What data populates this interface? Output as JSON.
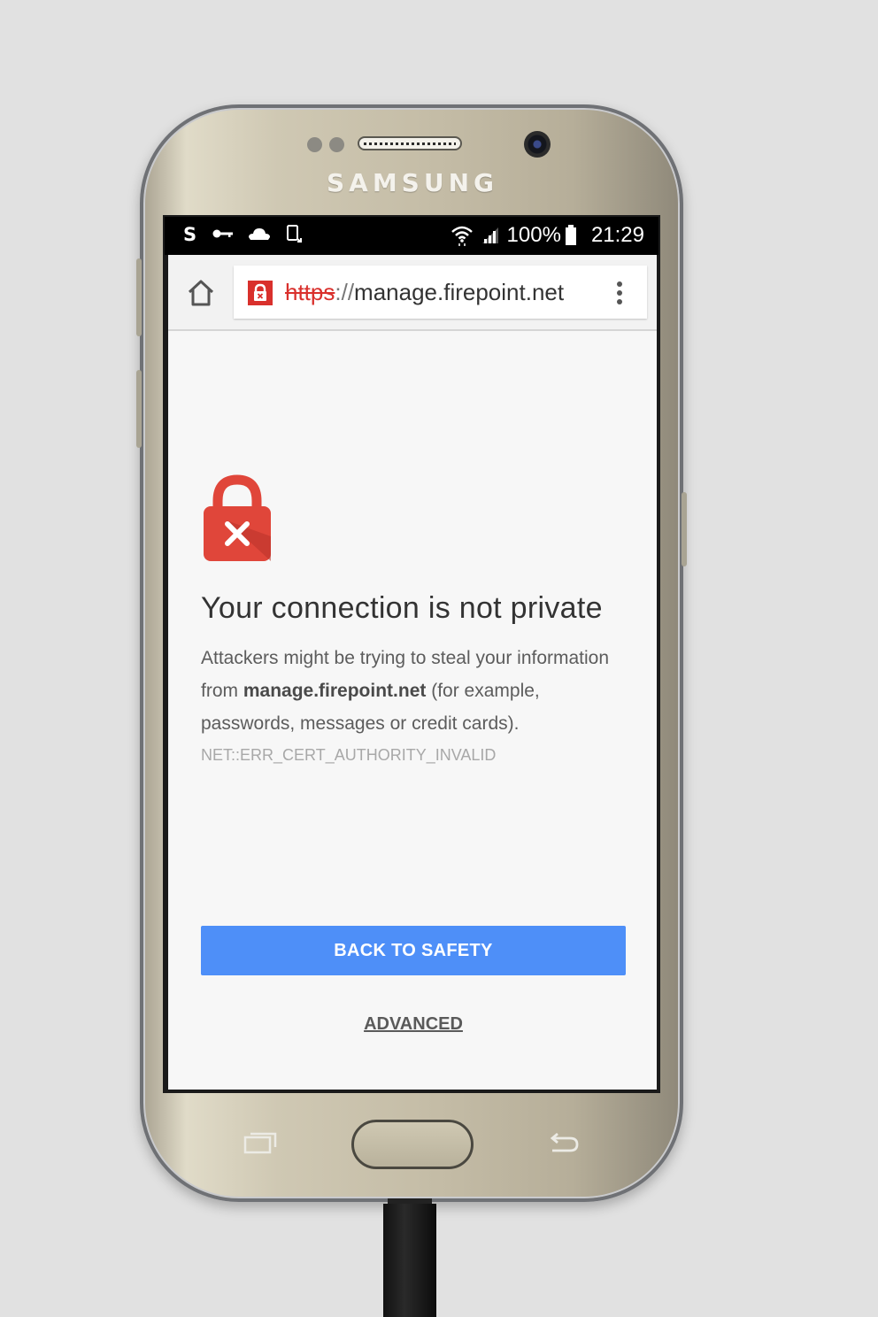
{
  "device": {
    "brand": "SAMSUNG"
  },
  "statusbar": {
    "left_icons": [
      "skype-icon",
      "vpn-key-icon",
      "cloud-icon",
      "device-rotate-icon"
    ],
    "right_icons": [
      "wifi-icon",
      "signal-icon",
      "battery-icon"
    ],
    "battery": "100%",
    "time": "21:29"
  },
  "browser": {
    "url_scheme": "https",
    "url_separator": "://",
    "url_host": "manage.firepoint.net"
  },
  "page": {
    "heading": "Your connection is not private",
    "body_prefix": "Attackers might be trying to steal your information from ",
    "body_host": "manage.firepoint.net",
    "body_suffix": " (for example, passwords, messages or credit cards).",
    "error_code": "NET::ERR_CERT_AUTHORITY_INVALID",
    "primary_button": "BACK TO SAFETY",
    "secondary_link": "ADVANCED"
  },
  "colors": {
    "accent": "#4e8ff8",
    "error_red": "#d9302c",
    "page_bg": "#f7f7f7"
  }
}
